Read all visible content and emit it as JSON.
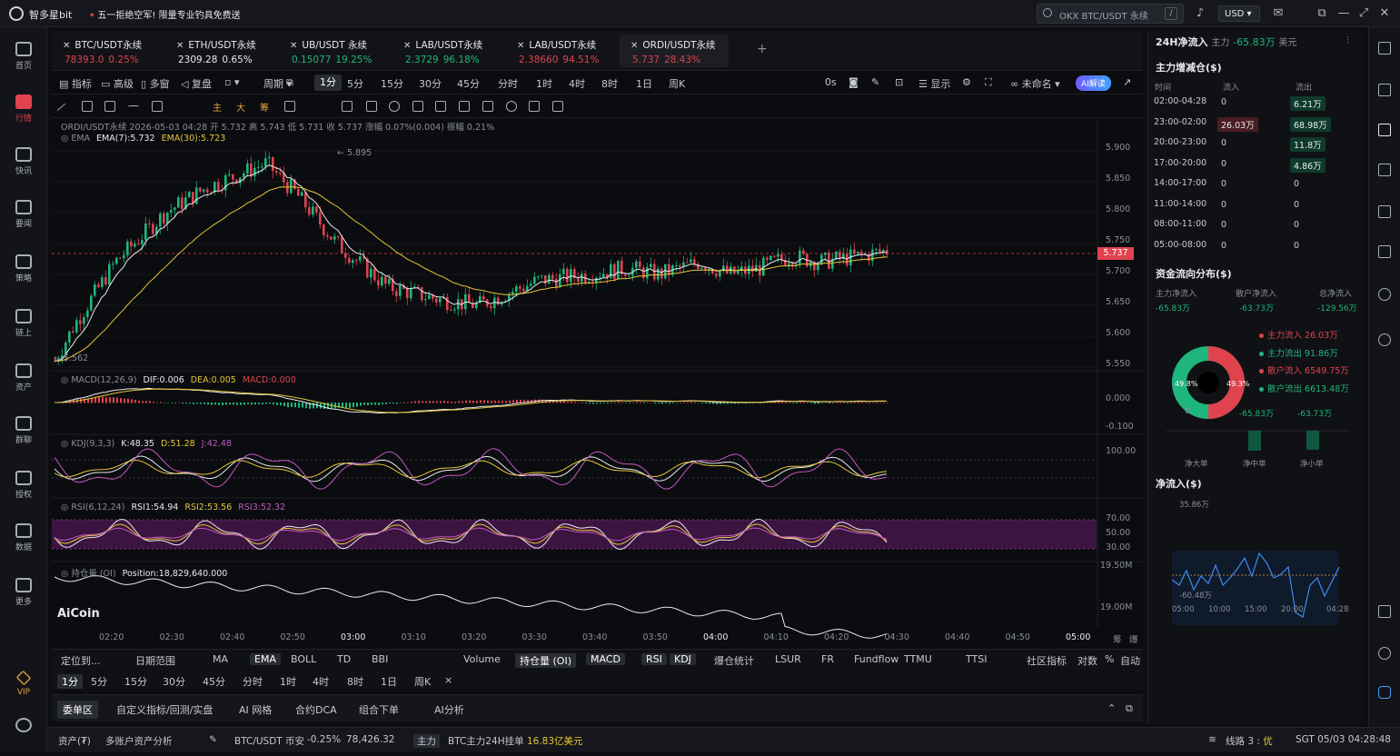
{
  "app": {
    "name": "智多星bit",
    "promo_tag": "•",
    "promo": "五一拒绝空军! 限量专业钓具免费送",
    "search_value": "OKX BTC/USDT 永续",
    "search_shortcut": "/",
    "currency": "USD"
  },
  "nav": [
    {
      "label": "首页",
      "icon": "home-icon"
    },
    {
      "label": "行情",
      "icon": "chart-icon",
      "active": true
    },
    {
      "label": "快讯",
      "icon": "news-icon"
    },
    {
      "label": "要闻",
      "icon": "doc-icon"
    },
    {
      "label": "策略",
      "icon": "strategy-icon"
    },
    {
      "label": "链上",
      "icon": "chain-icon"
    },
    {
      "label": "资产",
      "icon": "wallet-icon"
    },
    {
      "label": "群聊",
      "icon": "chat-icon"
    },
    {
      "label": "授权",
      "icon": "auth-icon"
    },
    {
      "label": "数据",
      "icon": "data-icon"
    },
    {
      "label": "更多",
      "icon": "grid-icon"
    }
  ],
  "nav_vip": "VIP",
  "tabs": [
    {
      "title": "BTC/USDT永续",
      "price": "78393.0",
      "change": "0.25%",
      "color": "red"
    },
    {
      "title": "ETH/USDT永续",
      "price": "2309.28",
      "change": "0.65%",
      "color": "white"
    },
    {
      "title": "UB/USDT 永续",
      "price": "0.15077",
      "change": "19.25%",
      "color": "green"
    },
    {
      "title": "LAB/USDT永续",
      "price": "2.3729",
      "change": "96.18%",
      "color": "green"
    },
    {
      "title": "LAB/USDT永续",
      "price": "2.38660",
      "change": "94.51%",
      "color": "red"
    },
    {
      "title": "ORDI/USDT永续",
      "price": "5.737",
      "change": "28.43%",
      "color": "red",
      "active": true
    }
  ],
  "toolbar1": {
    "items": [
      "指标",
      "高级",
      "多窗",
      "复盘"
    ],
    "period": "周期",
    "intervals": [
      "1分",
      "5分",
      "15分",
      "30分",
      "45分",
      "分时",
      "1时",
      "4时",
      "8时",
      "1日",
      "周K"
    ],
    "selected": "1分",
    "right": [
      "0s",
      "显示",
      "未命名"
    ],
    "ai": "AI解读"
  },
  "toolbar2": {
    "labels": [
      "主",
      "大",
      "筹"
    ]
  },
  "chart": {
    "info": "ORDI/USDT永续  2026-05-03 04:28  开 5.732  高 5.743  低 5.731  收 5.737  涨幅 0.07%(0.004)  振幅 0.21%",
    "ema_label": "EMA",
    "ema7": "EMA(7):5.732",
    "ema30": "EMA(30):5.723",
    "macd_label": "MACD(12,26,9)",
    "dif": "DIF:0.006",
    "dea": "DEA:0.005",
    "macd": "MACD:0.000",
    "kdj_label": "KDJ(9,3,3)",
    "k": "K:48.35",
    "d": "D:51.28",
    "j": "J:42.48",
    "rsi_label": "RSI(6,12,24)",
    "rsi1": "RSI1:54.94",
    "rsi2": "RSI2:53.56",
    "rsi3": "RSI3:52.32",
    "oi_label": "持仓量 (OI)",
    "oi": "Position:18,829,640.000",
    "high_mark": "5.895",
    "low_mark": "5.562",
    "last_price": "5.737",
    "y_main": [
      "5.900",
      "5.850",
      "5.800",
      "5.750",
      "5.700",
      "5.650",
      "5.600",
      "5.550"
    ],
    "y_macd": [
      "0.000",
      "-0.100"
    ],
    "y_kdj": [
      "100.00"
    ],
    "y_rsi": [
      "70.00",
      "50.00",
      "30.00"
    ],
    "y_oi": [
      "19.50M",
      "19.00M"
    ],
    "x_ticks": [
      "02:20",
      "02:30",
      "02:40",
      "02:50",
      "03:00",
      "03:10",
      "03:20",
      "03:30",
      "03:40",
      "03:50",
      "04:00",
      "04:10",
      "04:20",
      "04:30",
      "04:40",
      "04:50",
      "05:00"
    ],
    "x_corner": [
      "筹",
      "爆"
    ],
    "watermark": "AiCoin"
  },
  "chart_data": {
    "type": "candlestick",
    "symbol": "ORDI/USDT永续",
    "interval": "1分",
    "open": 5.732,
    "high": 5.743,
    "low": 5.731,
    "close": 5.737,
    "ylim": [
      5.53,
      5.92
    ],
    "range_high": 5.895,
    "range_low": 5.562
  },
  "ctrl1": {
    "left": [
      "定位到...",
      "日期范围"
    ],
    "indicators": [
      "MA",
      "EMA",
      "BOLL",
      "TD",
      "BBI"
    ],
    "sub": [
      "Volume",
      "持仓量 (OI)",
      "MACD",
      "RSI",
      "KDJ",
      "爆仓统计",
      "LSUR",
      "FR",
      "Fundflow",
      "TTMU",
      "TTSI"
    ],
    "right": [
      "社区指标",
      "对数",
      "%",
      "自动"
    ]
  },
  "ctrl2": {
    "intervals": [
      "1分",
      "5分",
      "15分",
      "30分",
      "45分",
      "分时",
      "1时",
      "4时",
      "8时",
      "1日",
      "周K"
    ],
    "close": "×"
  },
  "bottom_tabs": [
    "委单区",
    "自定义指标/回测/实盘",
    "AI 网格",
    "合约DCA",
    "组合下单",
    "AI分析"
  ],
  "status": {
    "assets": "资产(₮)",
    "account": "多账户资产分析",
    "pair": "BTC/USDT 币安",
    "change": "-0.25%",
    "price": "78,426.32",
    "tag": "主力",
    "note": "BTC主力24H挂单",
    "note_val": "16.83亿美元",
    "line": "线路 3 : ",
    "line_q": "优",
    "time": "SGT 05/03 04:28:48"
  },
  "right": {
    "title": "24H净流入",
    "sub": "主力",
    "sub_val": "-65.83万",
    "unit": "美元",
    "sec1": "主力增减仓($)",
    "head": [
      "时间",
      "流入",
      "流出"
    ],
    "rows": [
      [
        "02:00-04:28",
        "0",
        "6.21万"
      ],
      [
        "23:00-02:00",
        "26.03万",
        "68.98万"
      ],
      [
        "20:00-23:00",
        "0",
        "11.8万"
      ],
      [
        "17:00-20:00",
        "0",
        "4.86万"
      ],
      [
        "14:00-17:00",
        "0",
        "0"
      ],
      [
        "11:00-14:00",
        "0",
        "0"
      ],
      [
        "08:00-11:00",
        "0",
        "0"
      ],
      [
        "05:00-08:00",
        "0",
        "0"
      ]
    ],
    "sec2": "资金流向分布($)",
    "flow_heads": [
      "主力净流入",
      "散户净流入",
      "总净流入"
    ],
    "flow_vals": [
      "-65.83万",
      "-63.73万",
      "-129.56万"
    ],
    "pie_left": "49.8%",
    "pie_right": "49.3%",
    "legend": [
      [
        "主力流入 26.03万",
        "#e0434e"
      ],
      [
        "主力流出 91.86万",
        "#1fb67e"
      ],
      [
        "散户流入 6549.75万",
        "#e0434e"
      ],
      [
        "散户流出 6613.48万",
        "#1fb67e"
      ]
    ],
    "bar_vals": [
      "0",
      "-65.83万",
      "-63.73万"
    ],
    "bar_labels": [
      "净大单",
      "净中单",
      "净小单"
    ],
    "sec3": "净流入($)",
    "net_max": "35.86万",
    "net_min": "-60.48万",
    "net_x": [
      "05:00",
      "10:00",
      "15:00",
      "20:00",
      "04:28"
    ]
  }
}
